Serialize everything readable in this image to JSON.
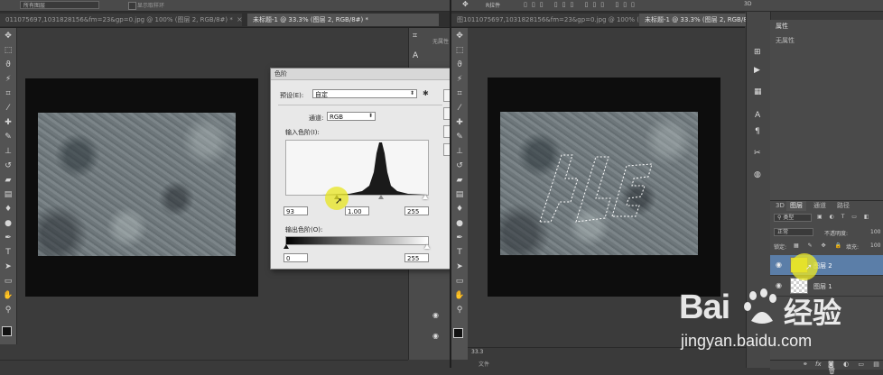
{
  "left_window": {
    "options": {
      "sample_select": "所有图层",
      "checkbox_label": "显示取样环"
    },
    "tabs": [
      {
        "label": "011075697,1031828156&fm=23&gp=0.jpg @ 100% (图层 2, RGB/8#) *",
        "active": false
      },
      {
        "label": "未标题-1 @ 33.3% (图层 2, RGB/8#) *",
        "active": true
      }
    ],
    "mini_panel": {
      "label": "无属性"
    }
  },
  "levels_dialog": {
    "title": "色阶",
    "preset_label": "预设(E):",
    "preset_value": "自定",
    "channel_label": "通道:",
    "channel_value": "RGB",
    "input_levels_label": "输入色阶(I):",
    "input_black": "93",
    "input_gamma": "1.00",
    "input_white": "255",
    "output_levels_label": "输出色阶(O):",
    "output_black": "0",
    "output_white": "255"
  },
  "right_window": {
    "options": {
      "label": "R拉件"
    },
    "tabs": [
      {
        "label": "图1011075697,1031828156&fm=23&gp=0.jpg @ 100% (图层 2, RGB/8#) *",
        "active": false
      },
      {
        "label": "未标题-1 @ 33.3% (图层 2, RGB/8#) *",
        "active": true
      }
    ],
    "zoom": "33.3",
    "status": "文件",
    "workspace": "3D"
  },
  "properties_panel": {
    "title": "属性",
    "content": "无属性"
  },
  "layers_panel": {
    "tabs": [
      "3D",
      "图层",
      "通道",
      "路径"
    ],
    "filter_kind": "类型",
    "blend_mode": "正常",
    "opacity_label": "不透明度:",
    "opacity_value": "100",
    "lock_label": "锁定:",
    "fill_label": "填充:",
    "fill_value": "100",
    "layers": [
      {
        "name": "图层 2",
        "selected": true
      },
      {
        "name": "图层 1",
        "selected": false
      }
    ],
    "footer": "fx"
  },
  "watermark": {
    "brand_prefix": "Bai",
    "brand_suffix": "经验",
    "url": "jingyan.baidu.com"
  },
  "colors": {
    "ps_dark": "#2f2f2f",
    "ps_panel": "#535353",
    "dialog_bg": "#e8e8e8",
    "highlight_yellow": "#e8e628",
    "selected_layer": "#5b7ea8"
  },
  "icons": [
    "move-icon",
    "marquee-icon",
    "lasso-icon",
    "magic-wand-icon",
    "crop-icon",
    "eyedropper-icon",
    "healing-icon",
    "brush-icon",
    "stamp-icon",
    "history-brush-icon",
    "eraser-icon",
    "gradient-icon",
    "blur-icon",
    "dodge-icon",
    "pen-icon",
    "type-icon",
    "path-select-icon",
    "shape-icon",
    "hand-icon",
    "zoom-icon",
    "foreground-color-icon"
  ]
}
